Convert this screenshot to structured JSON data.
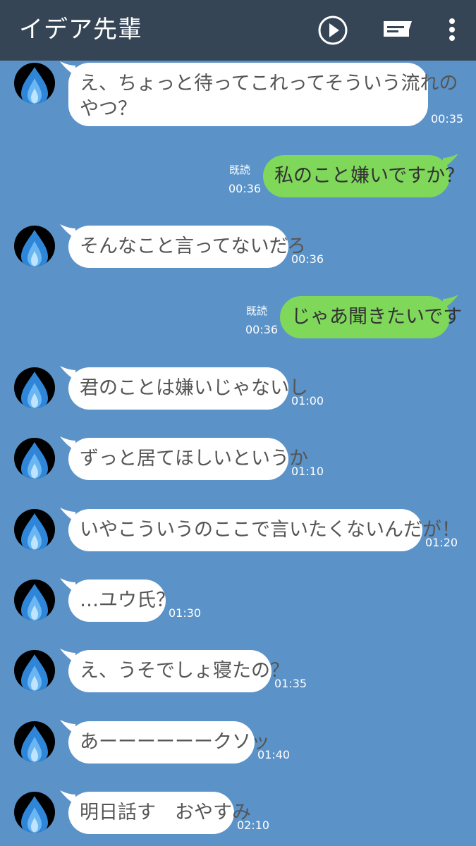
{
  "header": {
    "title": "イデア先輩",
    "icons": [
      "play-icon",
      "note-icon",
      "more-icon"
    ]
  },
  "colors": {
    "header_bg": "#354555",
    "chat_bg": "#5b93c9",
    "incoming_bubble": "#ffffff",
    "outgoing_bubble": "#7fd85a"
  },
  "messages": [
    {
      "side": "in",
      "lines": [
        "え、ちょっと待ってこれってそういう流れの",
        "やつ？"
      ],
      "time": "00:35"
    },
    {
      "side": "out",
      "lines": [
        "私のこと嫌いですか？"
      ],
      "time": "00:36",
      "read": "既読"
    },
    {
      "side": "in",
      "lines": [
        "そんなこと言ってないだろ"
      ],
      "time": "00:36"
    },
    {
      "side": "out",
      "lines": [
        "じゃあ聞きたいです"
      ],
      "time": "00:36",
      "read": "既読"
    },
    {
      "side": "in",
      "lines": [
        "君のことは嫌いじゃないし"
      ],
      "time": "01:00"
    },
    {
      "side": "in",
      "lines": [
        "ずっと居てほしいというか"
      ],
      "time": "01:10"
    },
    {
      "side": "in",
      "lines": [
        "いやこういうのここで言いたくないんだが！"
      ],
      "time": "01:20"
    },
    {
      "side": "in",
      "lines": [
        "…ユウ氏？"
      ],
      "time": "01:30"
    },
    {
      "side": "in",
      "lines": [
        "え、うそでしょ寝たの？"
      ],
      "time": "01:35"
    },
    {
      "side": "in",
      "lines": [
        "あーーーーーークソッ"
      ],
      "time": "01:40"
    },
    {
      "side": "in",
      "lines": [
        "明日話す　おやすみ"
      ],
      "time": "02:10"
    }
  ]
}
